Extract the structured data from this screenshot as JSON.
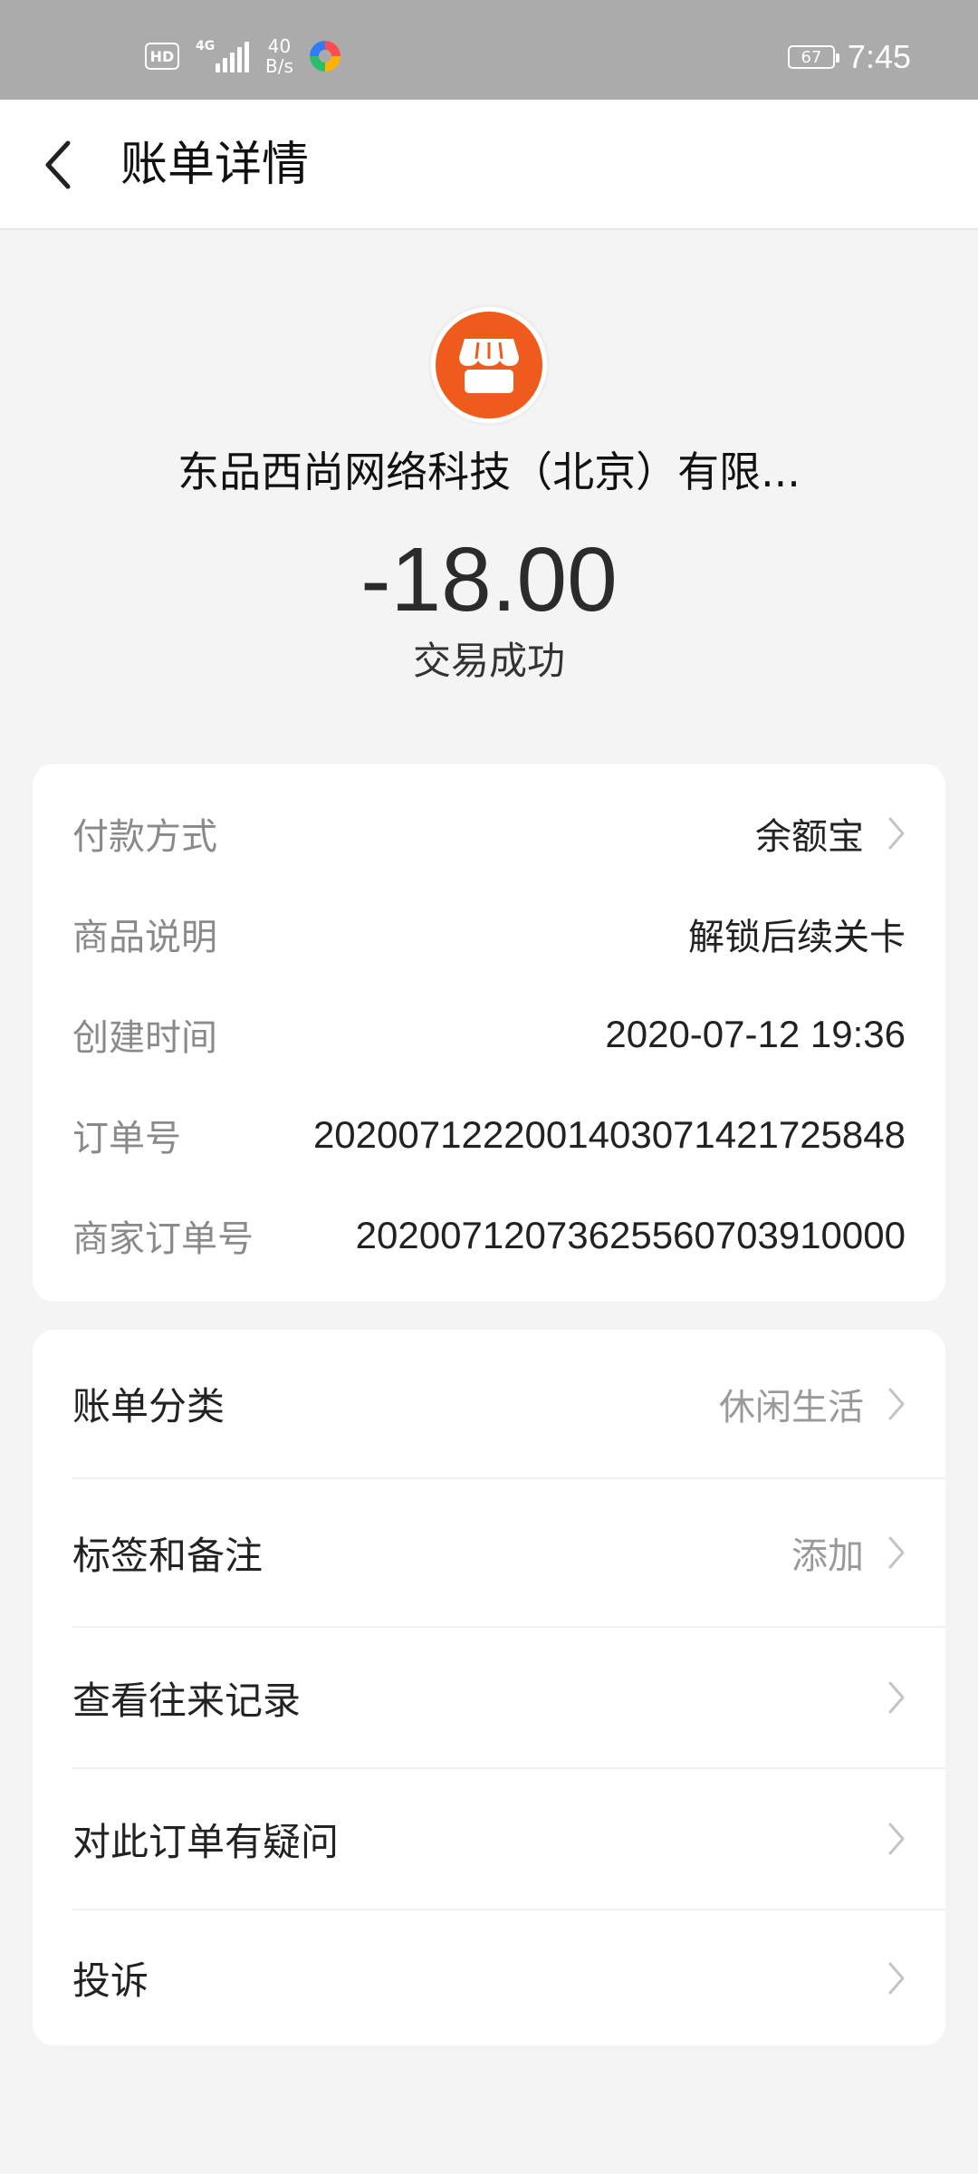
{
  "status_bar": {
    "hd": "HD",
    "network": "4G",
    "speed_value": "40",
    "speed_unit": "B/s",
    "battery": "67",
    "time": "7:45"
  },
  "header": {
    "title": "账单详情"
  },
  "summary": {
    "merchant": "东品西尚网络科技（北京）有限...",
    "amount": "-18.00",
    "status": "交易成功"
  },
  "details": {
    "payment_method_label": "付款方式",
    "payment_method_value": "余额宝",
    "product_label": "商品说明",
    "product_value": "解锁后续关卡",
    "created_label": "创建时间",
    "created_value": "2020-07-12 19:36",
    "order_no_label": "订单号",
    "order_no_value": "2020071222001403071421725848",
    "merchant_order_label": "商家订单号",
    "merchant_order_value": "20200712073625560703910000"
  },
  "actions": {
    "category_label": "账单分类",
    "category_value": "休闲生活",
    "tags_label": "标签和备注",
    "tags_value": "添加",
    "history_label": "查看往来记录",
    "question_label": "对此订单有疑问",
    "complaint_label": "投诉"
  },
  "colors": {
    "merchant_icon": "#ef5b1c",
    "status_bar": "#ababab",
    "background": "#f4f4f4"
  }
}
